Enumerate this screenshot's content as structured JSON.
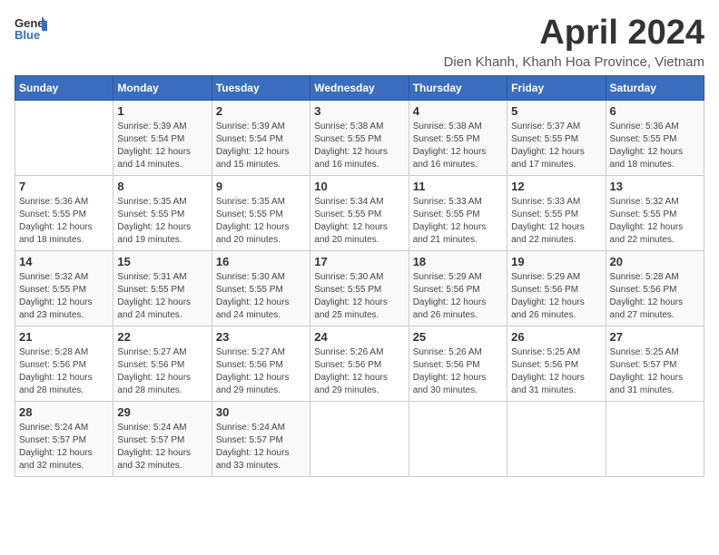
{
  "header": {
    "logo_general": "General",
    "logo_blue": "Blue",
    "month_title": "April 2024",
    "subtitle": "Dien Khanh, Khanh Hoa Province, Vietnam"
  },
  "days_of_week": [
    "Sunday",
    "Monday",
    "Tuesday",
    "Wednesday",
    "Thursday",
    "Friday",
    "Saturday"
  ],
  "weeks": [
    [
      {
        "day": "",
        "info": ""
      },
      {
        "day": "1",
        "info": "Sunrise: 5:39 AM\nSunset: 5:54 PM\nDaylight: 12 hours\nand 14 minutes."
      },
      {
        "day": "2",
        "info": "Sunrise: 5:39 AM\nSunset: 5:54 PM\nDaylight: 12 hours\nand 15 minutes."
      },
      {
        "day": "3",
        "info": "Sunrise: 5:38 AM\nSunset: 5:55 PM\nDaylight: 12 hours\nand 16 minutes."
      },
      {
        "day": "4",
        "info": "Sunrise: 5:38 AM\nSunset: 5:55 PM\nDaylight: 12 hours\nand 16 minutes."
      },
      {
        "day": "5",
        "info": "Sunrise: 5:37 AM\nSunset: 5:55 PM\nDaylight: 12 hours\nand 17 minutes."
      },
      {
        "day": "6",
        "info": "Sunrise: 5:36 AM\nSunset: 5:55 PM\nDaylight: 12 hours\nand 18 minutes."
      }
    ],
    [
      {
        "day": "7",
        "info": "Sunrise: 5:36 AM\nSunset: 5:55 PM\nDaylight: 12 hours\nand 18 minutes."
      },
      {
        "day": "8",
        "info": "Sunrise: 5:35 AM\nSunset: 5:55 PM\nDaylight: 12 hours\nand 19 minutes."
      },
      {
        "day": "9",
        "info": "Sunrise: 5:35 AM\nSunset: 5:55 PM\nDaylight: 12 hours\nand 20 minutes."
      },
      {
        "day": "10",
        "info": "Sunrise: 5:34 AM\nSunset: 5:55 PM\nDaylight: 12 hours\nand 20 minutes."
      },
      {
        "day": "11",
        "info": "Sunrise: 5:33 AM\nSunset: 5:55 PM\nDaylight: 12 hours\nand 21 minutes."
      },
      {
        "day": "12",
        "info": "Sunrise: 5:33 AM\nSunset: 5:55 PM\nDaylight: 12 hours\nand 22 minutes."
      },
      {
        "day": "13",
        "info": "Sunrise: 5:32 AM\nSunset: 5:55 PM\nDaylight: 12 hours\nand 22 minutes."
      }
    ],
    [
      {
        "day": "14",
        "info": "Sunrise: 5:32 AM\nSunset: 5:55 PM\nDaylight: 12 hours\nand 23 minutes."
      },
      {
        "day": "15",
        "info": "Sunrise: 5:31 AM\nSunset: 5:55 PM\nDaylight: 12 hours\nand 24 minutes."
      },
      {
        "day": "16",
        "info": "Sunrise: 5:30 AM\nSunset: 5:55 PM\nDaylight: 12 hours\nand 24 minutes."
      },
      {
        "day": "17",
        "info": "Sunrise: 5:30 AM\nSunset: 5:55 PM\nDaylight: 12 hours\nand 25 minutes."
      },
      {
        "day": "18",
        "info": "Sunrise: 5:29 AM\nSunset: 5:56 PM\nDaylight: 12 hours\nand 26 minutes."
      },
      {
        "day": "19",
        "info": "Sunrise: 5:29 AM\nSunset: 5:56 PM\nDaylight: 12 hours\nand 26 minutes."
      },
      {
        "day": "20",
        "info": "Sunrise: 5:28 AM\nSunset: 5:56 PM\nDaylight: 12 hours\nand 27 minutes."
      }
    ],
    [
      {
        "day": "21",
        "info": "Sunrise: 5:28 AM\nSunset: 5:56 PM\nDaylight: 12 hours\nand 28 minutes."
      },
      {
        "day": "22",
        "info": "Sunrise: 5:27 AM\nSunset: 5:56 PM\nDaylight: 12 hours\nand 28 minutes."
      },
      {
        "day": "23",
        "info": "Sunrise: 5:27 AM\nSunset: 5:56 PM\nDaylight: 12 hours\nand 29 minutes."
      },
      {
        "day": "24",
        "info": "Sunrise: 5:26 AM\nSunset: 5:56 PM\nDaylight: 12 hours\nand 29 minutes."
      },
      {
        "day": "25",
        "info": "Sunrise: 5:26 AM\nSunset: 5:56 PM\nDaylight: 12 hours\nand 30 minutes."
      },
      {
        "day": "26",
        "info": "Sunrise: 5:25 AM\nSunset: 5:56 PM\nDaylight: 12 hours\nand 31 minutes."
      },
      {
        "day": "27",
        "info": "Sunrise: 5:25 AM\nSunset: 5:57 PM\nDaylight: 12 hours\nand 31 minutes."
      }
    ],
    [
      {
        "day": "28",
        "info": "Sunrise: 5:24 AM\nSunset: 5:57 PM\nDaylight: 12 hours\nand 32 minutes."
      },
      {
        "day": "29",
        "info": "Sunrise: 5:24 AM\nSunset: 5:57 PM\nDaylight: 12 hours\nand 32 minutes."
      },
      {
        "day": "30",
        "info": "Sunrise: 5:24 AM\nSunset: 5:57 PM\nDaylight: 12 hours\nand 33 minutes."
      },
      {
        "day": "",
        "info": ""
      },
      {
        "day": "",
        "info": ""
      },
      {
        "day": "",
        "info": ""
      },
      {
        "day": "",
        "info": ""
      }
    ]
  ]
}
